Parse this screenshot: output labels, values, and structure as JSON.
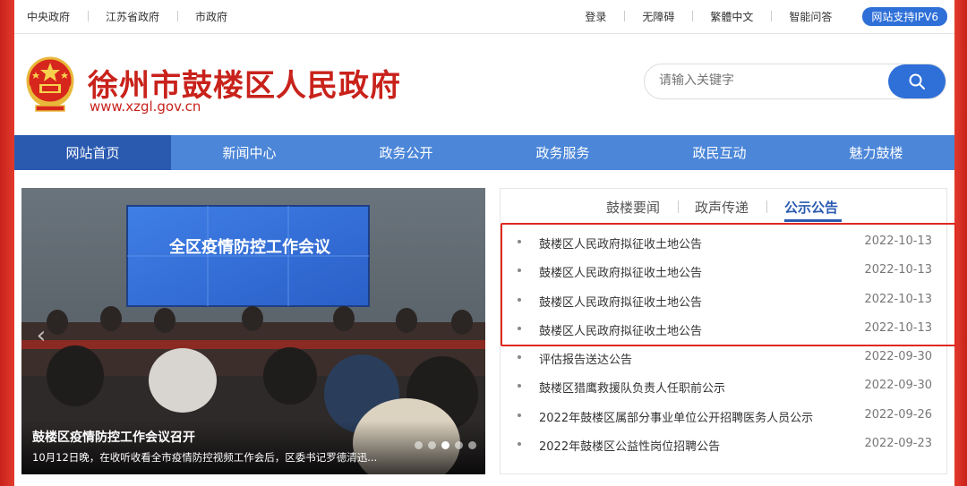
{
  "topbar": {
    "left_links": [
      "中央政府",
      "江苏省政府",
      "市政府"
    ],
    "right_links": [
      "登录",
      "无障碍",
      "繁體中文",
      "智能问答"
    ],
    "ipv6_badge": "网站支持IPV6"
  },
  "header": {
    "title": "徐州市鼓楼区人民政府",
    "url": "www.xzgl.gov.cn",
    "search_placeholder": "请输入关键字"
  },
  "nav": {
    "items": [
      "网站首页",
      "新闻中心",
      "政务公开",
      "政务服务",
      "政民互动",
      "魅力鼓楼"
    ]
  },
  "slider": {
    "screen_text": "全区疫情防控工作会议",
    "caption_title": "鼓楼区疫情防控工作会议召开",
    "caption_sub": "10月12日晚，在收听收看全市疫情防控视频工作会后，区委书记罗德清迅..."
  },
  "news": {
    "tabs": [
      "鼓楼要闻",
      "政声传递",
      "公示公告"
    ],
    "active_tab": "公示公告",
    "items": [
      {
        "title": "鼓楼区人民政府拟征收土地公告",
        "date": "2022-10-13"
      },
      {
        "title": "鼓楼区人民政府拟征收土地公告",
        "date": "2022-10-13"
      },
      {
        "title": "鼓楼区人民政府拟征收土地公告",
        "date": "2022-10-13"
      },
      {
        "title": "鼓楼区人民政府拟征收土地公告",
        "date": "2022-10-13"
      },
      {
        "title": "评估报告送达公告",
        "date": "2022-09-30"
      },
      {
        "title": "鼓楼区猎鹰救援队负责人任职前公示",
        "date": "2022-09-30"
      },
      {
        "title": "2022年鼓楼区属部分事业单位公开招聘医务人员公示",
        "date": "2022-09-26"
      },
      {
        "title": "2022年鼓楼区公益性岗位招聘公告",
        "date": "2022-09-23"
      }
    ]
  },
  "colors": {
    "brand_red": "#c8221b",
    "nav_blue": "#4b86d8",
    "nav_active": "#2a5ab0",
    "highlight": "#e0281f"
  }
}
